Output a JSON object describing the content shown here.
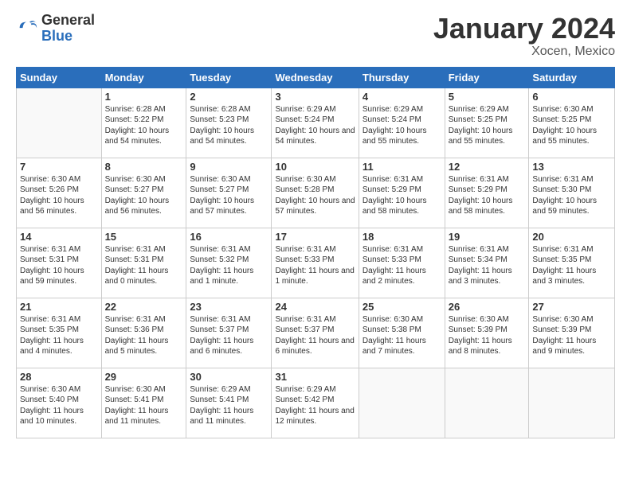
{
  "header": {
    "logo_general": "General",
    "logo_blue": "Blue",
    "month": "January 2024",
    "location": "Xocen, Mexico"
  },
  "weekdays": [
    "Sunday",
    "Monday",
    "Tuesday",
    "Wednesday",
    "Thursday",
    "Friday",
    "Saturday"
  ],
  "weeks": [
    [
      {
        "day": "",
        "sunrise": "",
        "sunset": "",
        "daylight": ""
      },
      {
        "day": "1",
        "sunrise": "Sunrise: 6:28 AM",
        "sunset": "Sunset: 5:22 PM",
        "daylight": "Daylight: 10 hours and 54 minutes."
      },
      {
        "day": "2",
        "sunrise": "Sunrise: 6:28 AM",
        "sunset": "Sunset: 5:23 PM",
        "daylight": "Daylight: 10 hours and 54 minutes."
      },
      {
        "day": "3",
        "sunrise": "Sunrise: 6:29 AM",
        "sunset": "Sunset: 5:24 PM",
        "daylight": "Daylight: 10 hours and 54 minutes."
      },
      {
        "day": "4",
        "sunrise": "Sunrise: 6:29 AM",
        "sunset": "Sunset: 5:24 PM",
        "daylight": "Daylight: 10 hours and 55 minutes."
      },
      {
        "day": "5",
        "sunrise": "Sunrise: 6:29 AM",
        "sunset": "Sunset: 5:25 PM",
        "daylight": "Daylight: 10 hours and 55 minutes."
      },
      {
        "day": "6",
        "sunrise": "Sunrise: 6:30 AM",
        "sunset": "Sunset: 5:25 PM",
        "daylight": "Daylight: 10 hours and 55 minutes."
      }
    ],
    [
      {
        "day": "7",
        "sunrise": "Sunrise: 6:30 AM",
        "sunset": "Sunset: 5:26 PM",
        "daylight": "Daylight: 10 hours and 56 minutes."
      },
      {
        "day": "8",
        "sunrise": "Sunrise: 6:30 AM",
        "sunset": "Sunset: 5:27 PM",
        "daylight": "Daylight: 10 hours and 56 minutes."
      },
      {
        "day": "9",
        "sunrise": "Sunrise: 6:30 AM",
        "sunset": "Sunset: 5:27 PM",
        "daylight": "Daylight: 10 hours and 57 minutes."
      },
      {
        "day": "10",
        "sunrise": "Sunrise: 6:30 AM",
        "sunset": "Sunset: 5:28 PM",
        "daylight": "Daylight: 10 hours and 57 minutes."
      },
      {
        "day": "11",
        "sunrise": "Sunrise: 6:31 AM",
        "sunset": "Sunset: 5:29 PM",
        "daylight": "Daylight: 10 hours and 58 minutes."
      },
      {
        "day": "12",
        "sunrise": "Sunrise: 6:31 AM",
        "sunset": "Sunset: 5:29 PM",
        "daylight": "Daylight: 10 hours and 58 minutes."
      },
      {
        "day": "13",
        "sunrise": "Sunrise: 6:31 AM",
        "sunset": "Sunset: 5:30 PM",
        "daylight": "Daylight: 10 hours and 59 minutes."
      }
    ],
    [
      {
        "day": "14",
        "sunrise": "Sunrise: 6:31 AM",
        "sunset": "Sunset: 5:31 PM",
        "daylight": "Daylight: 10 hours and 59 minutes."
      },
      {
        "day": "15",
        "sunrise": "Sunrise: 6:31 AM",
        "sunset": "Sunset: 5:31 PM",
        "daylight": "Daylight: 11 hours and 0 minutes."
      },
      {
        "day": "16",
        "sunrise": "Sunrise: 6:31 AM",
        "sunset": "Sunset: 5:32 PM",
        "daylight": "Daylight: 11 hours and 1 minute."
      },
      {
        "day": "17",
        "sunrise": "Sunrise: 6:31 AM",
        "sunset": "Sunset: 5:33 PM",
        "daylight": "Daylight: 11 hours and 1 minute."
      },
      {
        "day": "18",
        "sunrise": "Sunrise: 6:31 AM",
        "sunset": "Sunset: 5:33 PM",
        "daylight": "Daylight: 11 hours and 2 minutes."
      },
      {
        "day": "19",
        "sunrise": "Sunrise: 6:31 AM",
        "sunset": "Sunset: 5:34 PM",
        "daylight": "Daylight: 11 hours and 3 minutes."
      },
      {
        "day": "20",
        "sunrise": "Sunrise: 6:31 AM",
        "sunset": "Sunset: 5:35 PM",
        "daylight": "Daylight: 11 hours and 3 minutes."
      }
    ],
    [
      {
        "day": "21",
        "sunrise": "Sunrise: 6:31 AM",
        "sunset": "Sunset: 5:35 PM",
        "daylight": "Daylight: 11 hours and 4 minutes."
      },
      {
        "day": "22",
        "sunrise": "Sunrise: 6:31 AM",
        "sunset": "Sunset: 5:36 PM",
        "daylight": "Daylight: 11 hours and 5 minutes."
      },
      {
        "day": "23",
        "sunrise": "Sunrise: 6:31 AM",
        "sunset": "Sunset: 5:37 PM",
        "daylight": "Daylight: 11 hours and 6 minutes."
      },
      {
        "day": "24",
        "sunrise": "Sunrise: 6:31 AM",
        "sunset": "Sunset: 5:37 PM",
        "daylight": "Daylight: 11 hours and 6 minutes."
      },
      {
        "day": "25",
        "sunrise": "Sunrise: 6:30 AM",
        "sunset": "Sunset: 5:38 PM",
        "daylight": "Daylight: 11 hours and 7 minutes."
      },
      {
        "day": "26",
        "sunrise": "Sunrise: 6:30 AM",
        "sunset": "Sunset: 5:39 PM",
        "daylight": "Daylight: 11 hours and 8 minutes."
      },
      {
        "day": "27",
        "sunrise": "Sunrise: 6:30 AM",
        "sunset": "Sunset: 5:39 PM",
        "daylight": "Daylight: 11 hours and 9 minutes."
      }
    ],
    [
      {
        "day": "28",
        "sunrise": "Sunrise: 6:30 AM",
        "sunset": "Sunset: 5:40 PM",
        "daylight": "Daylight: 11 hours and 10 minutes."
      },
      {
        "day": "29",
        "sunrise": "Sunrise: 6:30 AM",
        "sunset": "Sunset: 5:41 PM",
        "daylight": "Daylight: 11 hours and 11 minutes."
      },
      {
        "day": "30",
        "sunrise": "Sunrise: 6:29 AM",
        "sunset": "Sunset: 5:41 PM",
        "daylight": "Daylight: 11 hours and 11 minutes."
      },
      {
        "day": "31",
        "sunrise": "Sunrise: 6:29 AM",
        "sunset": "Sunset: 5:42 PM",
        "daylight": "Daylight: 11 hours and 12 minutes."
      },
      {
        "day": "",
        "sunrise": "",
        "sunset": "",
        "daylight": ""
      },
      {
        "day": "",
        "sunrise": "",
        "sunset": "",
        "daylight": ""
      },
      {
        "day": "",
        "sunrise": "",
        "sunset": "",
        "daylight": ""
      }
    ]
  ]
}
